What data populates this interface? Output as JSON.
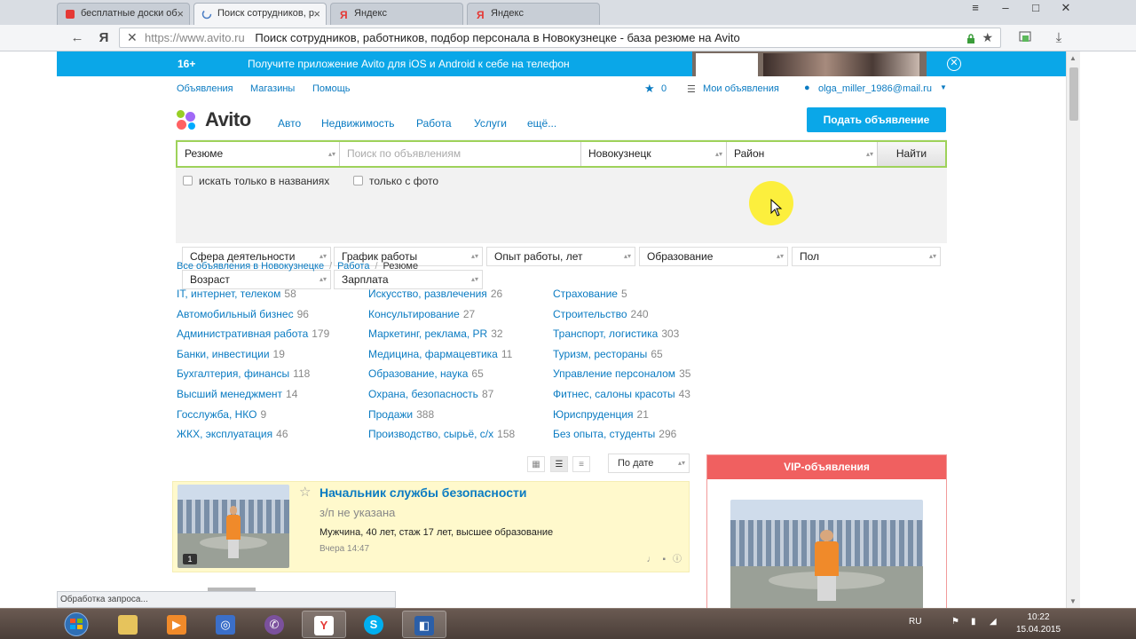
{
  "browser": {
    "tabs": [
      {
        "label": "бесплатные доски об",
        "active": false
      },
      {
        "label": "Поиск сотрудников, р",
        "active": true
      },
      {
        "label": "Яндекс",
        "active": false
      },
      {
        "label": "Яндекс",
        "active": false
      }
    ],
    "url_host": "https://www.avito.ru",
    "url_title": "Поиск сотрудников, работников, подбор персонала в Новокузнецке - база резюме на Avito",
    "ya_button": "Я"
  },
  "promo": {
    "age": "16+",
    "text": "Получите приложение Avito для iOS и Android к себе на телефон"
  },
  "toplinks": {
    "ads": "Объявления",
    "shops": "Магазины",
    "help": "Помощь",
    "fav_count": "0",
    "my_ads": "Мои объявления",
    "user": "olga_miller_1986@mail.ru"
  },
  "header": {
    "logo": "Avito",
    "nav": [
      "Авто",
      "Недвижимость",
      "Работа",
      "Услуги",
      "ещё..."
    ],
    "post_button": "Подать объявление"
  },
  "search": {
    "category": "Резюме",
    "query_placeholder": "Поиск по объявлениям",
    "city": "Новокузнецк",
    "district": "Район",
    "find_button": "Найти",
    "check_titles": "искать только в названиях",
    "check_photo": "только с фото",
    "filters_row1": [
      "Сфера деятельности",
      "График работы",
      "Опыт работы, лет",
      "Образование",
      "Пол"
    ],
    "filters_row2": [
      "Возраст",
      "Зарплата"
    ]
  },
  "breadcrumbs": {
    "all": "Все объявления в Новокузнецке",
    "work": "Работа",
    "current": "Резюме"
  },
  "categories": {
    "col1": [
      {
        "label": "IT, интернет, телеком",
        "count": "58"
      },
      {
        "label": "Автомобильный бизнес",
        "count": "96"
      },
      {
        "label": "Административная работа",
        "count": "179"
      },
      {
        "label": "Банки, инвестиции",
        "count": "19"
      },
      {
        "label": "Бухгалтерия, финансы",
        "count": "118"
      },
      {
        "label": "Высший менеджмент",
        "count": "14"
      },
      {
        "label": "Госслужба, НКО",
        "count": "9"
      },
      {
        "label": "ЖКХ, эксплуатация",
        "count": "46"
      }
    ],
    "col2": [
      {
        "label": "Искусство, развлечения",
        "count": "26"
      },
      {
        "label": "Консультирование",
        "count": "27"
      },
      {
        "label": "Маркетинг, реклама, PR",
        "count": "32"
      },
      {
        "label": "Медицина, фармацевтика",
        "count": "11"
      },
      {
        "label": "Образование, наука",
        "count": "65"
      },
      {
        "label": "Охрана, безопасность",
        "count": "87"
      },
      {
        "label": "Продажи",
        "count": "388"
      },
      {
        "label": "Производство, сырьё, с/х",
        "count": "158"
      }
    ],
    "col3": [
      {
        "label": "Страхование",
        "count": "5"
      },
      {
        "label": "Строительство",
        "count": "240"
      },
      {
        "label": "Транспорт, логистика",
        "count": "303"
      },
      {
        "label": "Туризм, рестораны",
        "count": "65"
      },
      {
        "label": "Управление персоналом",
        "count": "35"
      },
      {
        "label": "Фитнес, салоны красоты",
        "count": "43"
      },
      {
        "label": "Юриспруденция",
        "count": "21"
      },
      {
        "label": "Без опыта, студенты",
        "count": "296"
      }
    ]
  },
  "listing": {
    "sort": "По дате",
    "vip_title": "VIP-объявления",
    "item": {
      "title": "Начальник службы безопасности",
      "price": "з/п не указана",
      "desc": "Мужчина, 40 лет, стаж 17 лет, высшее образование",
      "date": "Вчера 14:47",
      "photo_count": "1"
    }
  },
  "status_text": "Обработка запроса...",
  "taskbar": {
    "lang": "RU",
    "time": "10:22",
    "date": "15.04.2015"
  },
  "colors": {
    "avito_blue": "#0aa7e8",
    "link_blue": "#0a7bc2",
    "search_green": "#9ed25a",
    "vip_red": "#f06060",
    "highlight_yellow": "#fff9cc"
  }
}
